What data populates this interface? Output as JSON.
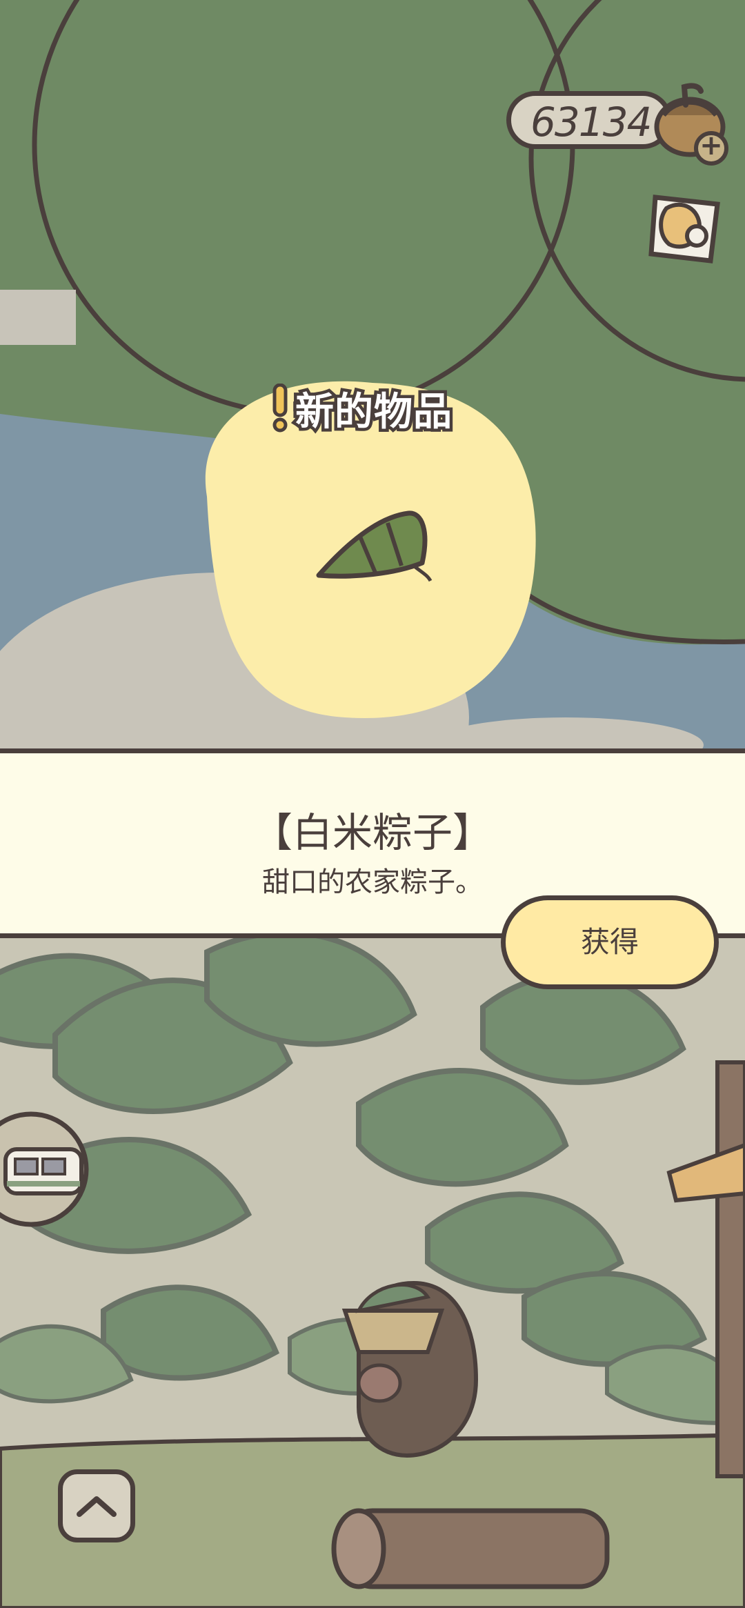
{
  "hud": {
    "clover_count": "63134",
    "clover_icon": "clover-icon",
    "plus_icon": "plus-icon",
    "album_icon": "album-icon"
  },
  "popup": {
    "banner_label": "新的物品",
    "item_name": "【白米粽子】",
    "item_description": "甜口的农家粽子。",
    "obtain_label": "获得",
    "item_icon": "zongzi-icon"
  },
  "nav": {
    "up_icon": "chevron-up-icon",
    "train_icon": "train-icon"
  },
  "colors": {
    "outline": "#4a3f3c",
    "panel": "#fefce8",
    "button": "#ffeaa4",
    "spotlight": "#fcedaa",
    "leaf_green": "#6f8a64",
    "sky": "#7f96a5"
  }
}
